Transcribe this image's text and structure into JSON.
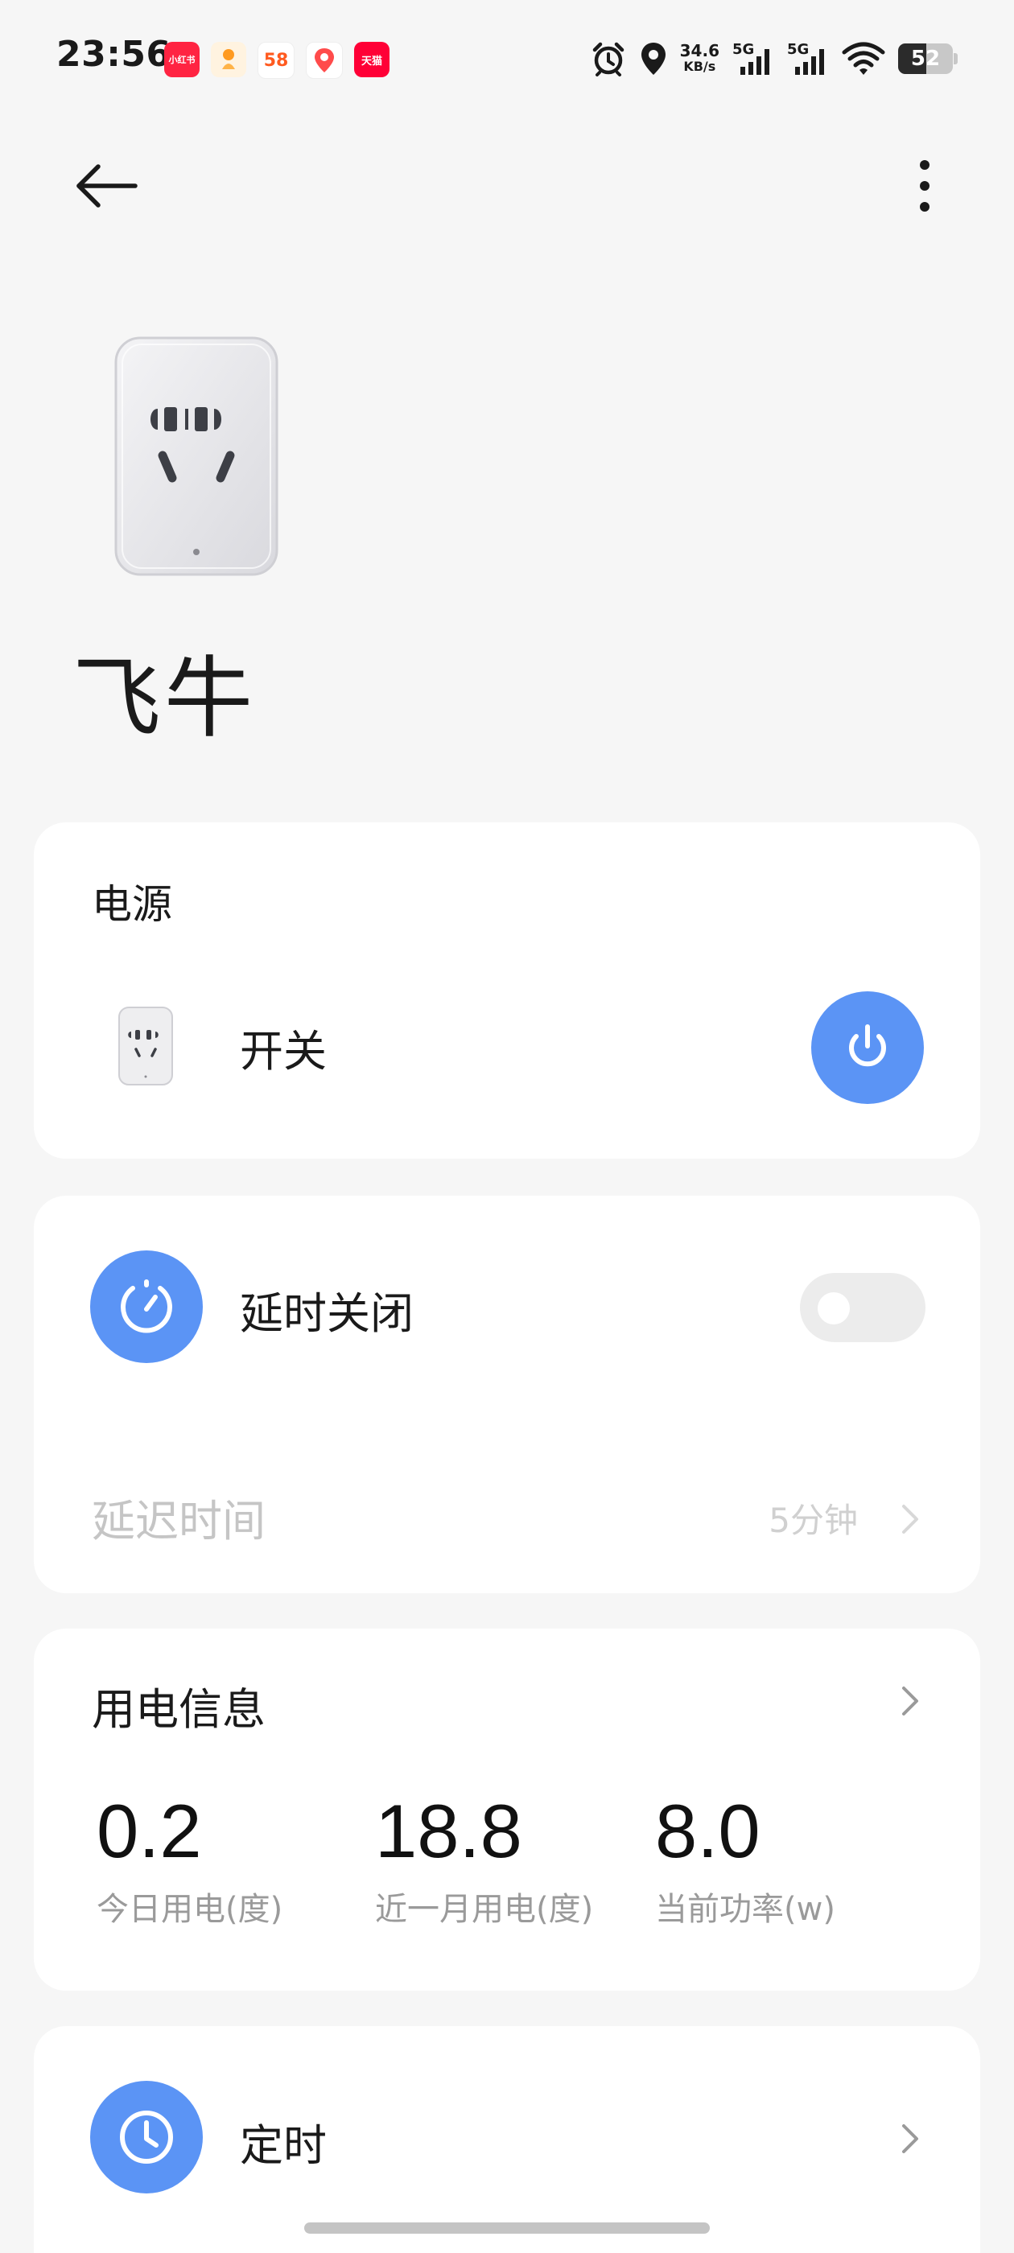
{
  "status_bar": {
    "time": "23:56",
    "app_icons": [
      {
        "name": "xiaohongshu-app-icon",
        "label": "小红书",
        "color": "#ff2442"
      },
      {
        "name": "app-icon-orange",
        "label": "",
        "color": "#ffb020"
      },
      {
        "name": "58-app-icon",
        "label": "58",
        "color": "#ff5a1f"
      },
      {
        "name": "map-app-icon",
        "label": "",
        "color": "#ffffff"
      },
      {
        "name": "tmall-app-icon",
        "label": "天猫",
        "color": "#ff0036"
      }
    ],
    "net_speed": "34.6",
    "net_speed_unit": "KB/s",
    "signal1_label": "5G",
    "signal2_label": "5G",
    "battery": "52",
    "battery_level": 0.52
  },
  "nav": {
    "back_icon": "arrow-left-icon",
    "more_icon": "more-vertical-icon"
  },
  "device": {
    "name": "飞牛"
  },
  "power_card": {
    "title": "电源",
    "switch_label": "开关",
    "power_button_color": "#5b94f5"
  },
  "delay_card": {
    "title": "延时关闭",
    "toggle_on": false,
    "delay_label": "延迟时间",
    "delay_value": "5分钟"
  },
  "energy_card": {
    "title": "用电信息",
    "stats": [
      {
        "value": "0.2",
        "label": "今日用电(度)"
      },
      {
        "value": "18.8",
        "label": "近一月用电(度)"
      },
      {
        "value": "8.0",
        "label": "当前功率(w)"
      }
    ]
  },
  "timer_card": {
    "title": "定时"
  },
  "colors": {
    "accent": "#5b94f5",
    "background": "#f6f6f6",
    "card": "#ffffff"
  }
}
